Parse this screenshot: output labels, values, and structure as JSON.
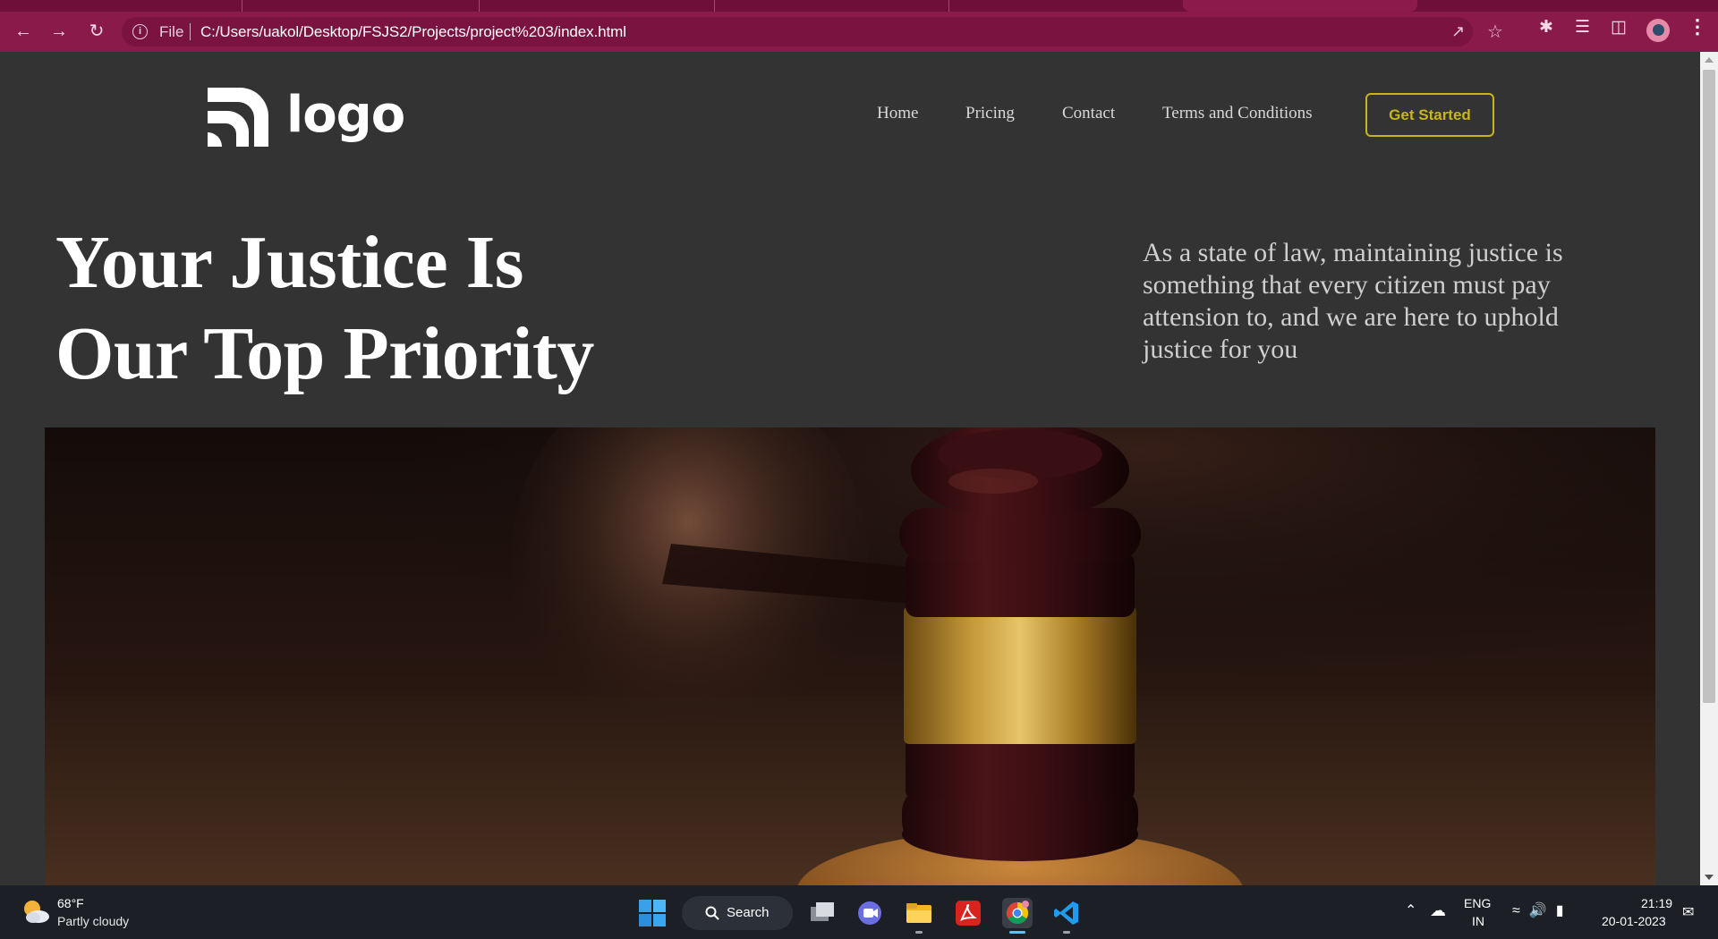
{
  "browser": {
    "url_scheme": "File",
    "url": "C:/Users/uakol/Desktop/FSJS2/Projects/project%203/index.html",
    "theme_color": "#8a1a4a"
  },
  "site": {
    "logo_text": "logo",
    "nav": [
      "Home",
      "Pricing",
      "Contact",
      "Terms and Conditions"
    ],
    "cta_label": "Get Started",
    "cta_color": "#c8b51e",
    "hero_title_line1": "Your Justice Is",
    "hero_title_line2": "Our Top Priority",
    "hero_text": "As a state of law, maintaining justice is something that every citizen must pay attension to, and we are here to uphold justice for you",
    "background_color": "#333333"
  },
  "taskbar": {
    "weather_temp": "68°F",
    "weather_desc": "Partly cloudy",
    "search_label": "Search",
    "lang_line1": "ENG",
    "lang_line2": "IN",
    "time": "21:19",
    "date": "20-01-2023",
    "apps": [
      "start-icon",
      "task-view-icon",
      "teams-chat-icon",
      "file-explorer-icon",
      "acrobat-icon",
      "chrome-icon",
      "vscode-icon"
    ]
  }
}
